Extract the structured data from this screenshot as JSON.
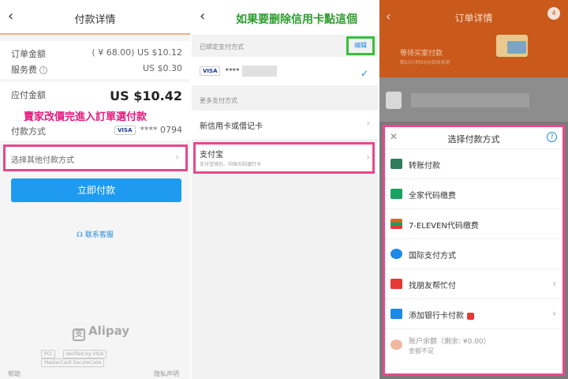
{
  "panel1": {
    "title": "付款详情",
    "back_glyph": "‹",
    "order_amount_label": "订单金额",
    "order_amount_value": "( ¥ 68.00) US $10.12",
    "service_fee_label": "服务费",
    "service_fee_value": "US $0.30",
    "payable_label": "应付金额",
    "payable_value": "US $10.42",
    "annotation": "賣家改價完進入訂單選付款",
    "payment_method_label": "付款方式",
    "card_brand": "VISA",
    "card_number": "**** 0794",
    "other_method_label": "选择其他付款方式",
    "pay_now_button": "立即付款",
    "contact_link": "联系客服",
    "logo_text": "Alipay",
    "cert_badges": [
      "PCI",
      "Verified by VISA",
      "MasterCard SecureCode"
    ],
    "footer_left": "帮助",
    "footer_right": "隐私声明"
  },
  "panel2": {
    "back_glyph": "‹",
    "annotation": "如果要删除信用卡點這個",
    "bound_section_label": "已绑定支付方式",
    "edit_link": "编辑",
    "card_brand": "VISA",
    "card_masked": "****",
    "more_section_label": "更多支付方式",
    "new_card_label": "新信用卡或借记卡",
    "alipay_label": "支付宝",
    "alipay_sub": "支付宝钱包、中国大陆银行卡"
  },
  "panel3": {
    "title": "订单详情",
    "badge_count": "4",
    "waiting_text": "等待买家付款",
    "waiting_sub": "剩23小时59分自动关闭",
    "sheet_title": "选择付款方式",
    "methods": [
      {
        "label": "转账付款",
        "icon": "transfer-icon",
        "color": "#2e7d5b"
      },
      {
        "label": "全家代码缴费",
        "icon": "familymart-icon",
        "color": "#1aa260"
      },
      {
        "label": "7-ELEVEN代码缴费",
        "icon": "seven-eleven-icon",
        "color": "#e8611a"
      },
      {
        "label": "国际支付方式",
        "icon": "globe-icon",
        "color": "#1e88e5"
      },
      {
        "label": "找朋友帮忙付",
        "icon": "friend-pay-icon",
        "color": "#e53935"
      },
      {
        "label": "添加银行卡付款",
        "icon": "bank-card-icon",
        "color": "#1e88e5"
      }
    ],
    "balance_label": "账户余额（剩余: ¥0.00）",
    "balance_sub": "金额不足"
  }
}
